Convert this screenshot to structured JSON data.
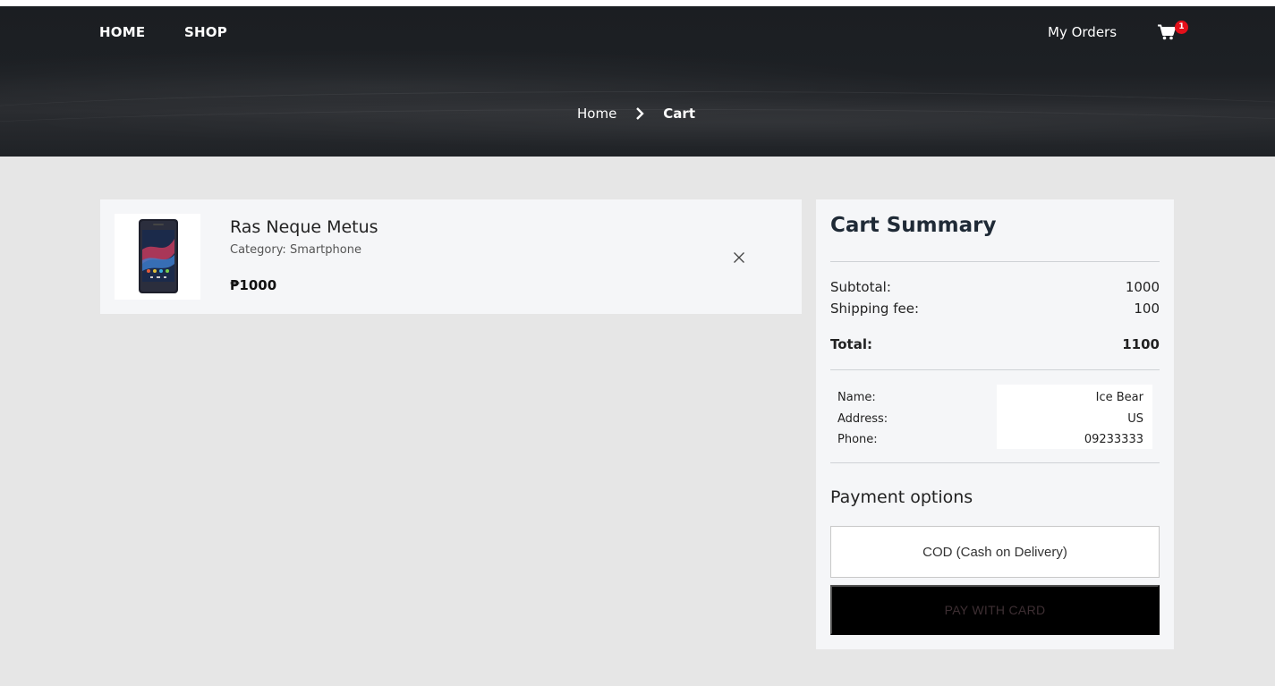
{
  "nav": {
    "home_label": "HOME",
    "shop_label": "SHOP",
    "orders_label": "My Orders",
    "cart_count": "1"
  },
  "breadcrumb": {
    "home": "Home",
    "current": "Cart"
  },
  "cart_items": [
    {
      "name": "Ras Neque Metus",
      "category": "Category: Smartphone",
      "price": "₱1000",
      "image_icon": "smartphone-image"
    }
  ],
  "summary": {
    "title": "Cart Summary",
    "subtotal_label": "Subtotal:",
    "subtotal_value": "1000",
    "shipping_label": "Shipping fee:",
    "shipping_value": "100",
    "total_label": "Total:",
    "total_value": "1100",
    "customer": {
      "name_label": "Name:",
      "name_value": "Ice Bear",
      "address_label": "Address:",
      "address_value": "US",
      "phone_label": "Phone:",
      "phone_value": "09233333"
    },
    "payment_title": "Payment options",
    "cod_label": "COD (Cash on Delivery)",
    "card_label": "PAY WITH CARD"
  },
  "colors": {
    "header_bg": "#1d2024",
    "page_bg": "#e6e6e6",
    "panel_bg": "#f5f6f8",
    "badge": "#e3101a",
    "card_button_bg": "#000000"
  }
}
